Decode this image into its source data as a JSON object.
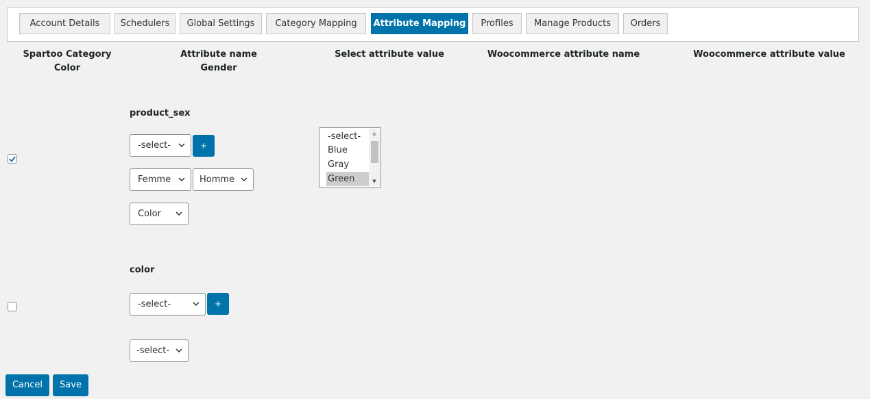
{
  "tabs": [
    {
      "label": "Account Details"
    },
    {
      "label": "Schedulers"
    },
    {
      "label": "Global Settings"
    },
    {
      "label": "Category Mapping"
    },
    {
      "label": "Attribute Mapping"
    },
    {
      "label": "Profiles"
    },
    {
      "label": "Manage Products"
    },
    {
      "label": "Orders"
    }
  ],
  "active_tab": "Attribute Mapping",
  "columns": {
    "spartoo_category": {
      "label": "Spartoo Category",
      "value": "Color"
    },
    "attribute_name": {
      "label": "Attribute name",
      "value": "Gender"
    },
    "select_attribute_value": {
      "label": "Select attribute value"
    },
    "woo_attribute_name": {
      "label": "Woocommerce attribute name"
    },
    "woo_attribute_value": {
      "label": "Woocommerce attribute value"
    }
  },
  "rows": [
    {
      "attribute": "product_sex",
      "checked": true,
      "select_value": "-select-",
      "add_label": "+",
      "mapping_selects": [
        "Femme",
        "Homme"
      ],
      "woo_select": "Color",
      "options": [
        "-select-",
        "Blue",
        "Gray",
        "Green"
      ],
      "highlighted_option": "Green"
    },
    {
      "attribute": "color",
      "checked": false,
      "select_value": "-select-",
      "add_label": "+",
      "second_select": "-select-"
    }
  ],
  "buttons": {
    "cancel": "Cancel",
    "save": "Save"
  },
  "colors": {
    "accent": "#0073aa",
    "background": "#f1f1f1",
    "border": "#8c8f94"
  }
}
